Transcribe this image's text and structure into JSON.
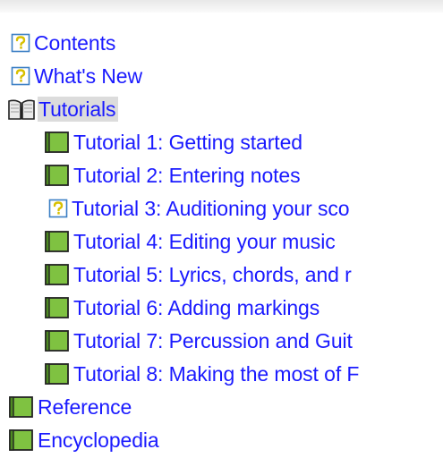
{
  "tree": {
    "items": [
      {
        "label": "Contents",
        "icon": "help-page-icon",
        "level": 0,
        "selected": false
      },
      {
        "label": "What's New",
        "icon": "help-page-icon",
        "level": 0,
        "selected": false
      },
      {
        "label": "Tutorials",
        "icon": "open-book-icon",
        "level": 0,
        "selected": true
      },
      {
        "label": "Tutorial 1: Getting started",
        "icon": "closed-book-icon",
        "level": 1,
        "selected": false
      },
      {
        "label": "Tutorial 2: Entering notes",
        "icon": "closed-book-icon",
        "level": 1,
        "selected": false
      },
      {
        "label": "Tutorial 3: Auditioning your sco",
        "icon": "help-page-icon",
        "level": 1,
        "selected": false
      },
      {
        "label": "Tutorial 4: Editing your music",
        "icon": "closed-book-icon",
        "level": 1,
        "selected": false
      },
      {
        "label": "Tutorial 5: Lyrics, chords, and r",
        "icon": "closed-book-icon",
        "level": 1,
        "selected": false
      },
      {
        "label": "Tutorial 6: Adding markings",
        "icon": "closed-book-icon",
        "level": 1,
        "selected": false
      },
      {
        "label": "Tutorial 7: Percussion and Guit",
        "icon": "closed-book-icon",
        "level": 1,
        "selected": false
      },
      {
        "label": "Tutorial 8: Making the most of F",
        "icon": "closed-book-icon",
        "level": 1,
        "selected": false
      },
      {
        "label": "Reference",
        "icon": "closed-book-icon",
        "level": 0,
        "selected": false
      },
      {
        "label": "Encyclopedia",
        "icon": "closed-book-icon",
        "level": 0,
        "selected": false
      }
    ]
  },
  "colors": {
    "link": "#1a1aff",
    "book_green": "#7fc241",
    "book_green_dark": "#4e8a22",
    "help_page_border": "#3b7fc4",
    "help_question": "#d8c000",
    "selection": "#dcdcdc"
  }
}
